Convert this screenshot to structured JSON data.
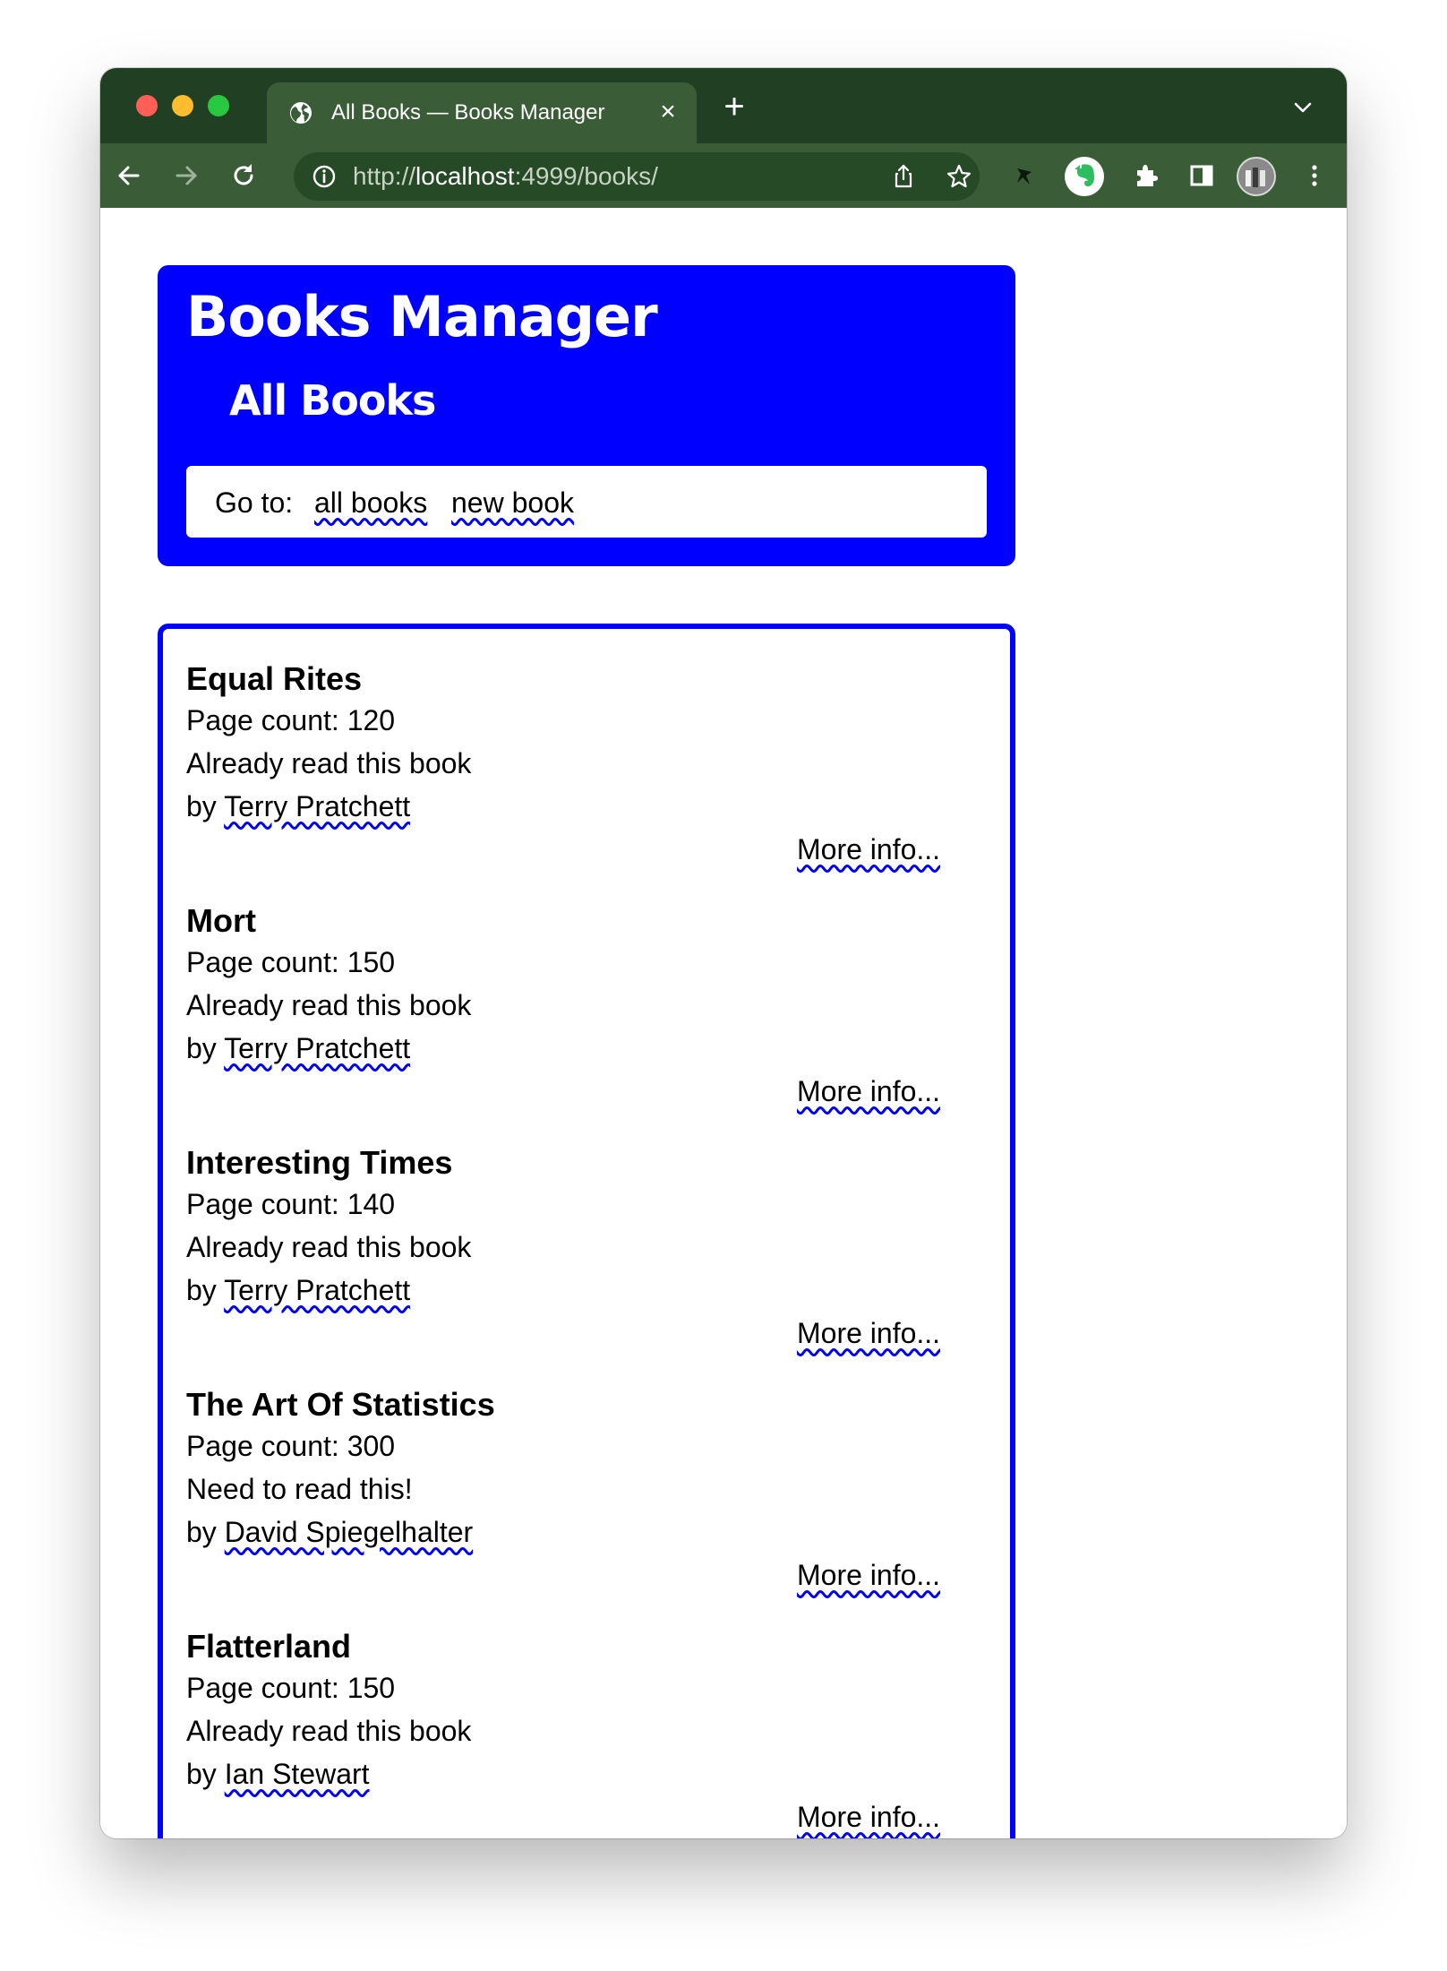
{
  "browser": {
    "tab_title": "All Books — Books Manager",
    "tab_close": "×",
    "new_tab": "+",
    "url_prefix": "http://",
    "url_host": "localhost",
    "url_rest": ":4999/books/"
  },
  "header": {
    "site_title": "Books Manager",
    "page_heading": "All Books",
    "nav_label": "Go to:",
    "nav_links": [
      "all books",
      "new book"
    ]
  },
  "books": [
    {
      "title": "Equal Rites",
      "pages": "Page count: 120",
      "status": "Already read this book",
      "by": "by",
      "author": "Terry Pratchett",
      "more": "More info..."
    },
    {
      "title": "Mort",
      "pages": "Page count: 150",
      "status": "Already read this book",
      "by": "by",
      "author": "Terry Pratchett",
      "more": "More info..."
    },
    {
      "title": "Interesting Times",
      "pages": "Page count: 140",
      "status": "Already read this book",
      "by": "by",
      "author": "Terry Pratchett",
      "more": "More info..."
    },
    {
      "title": "The Art Of Statistics",
      "pages": "Page count: 300",
      "status": "Need to read this!",
      "by": "by",
      "author": "David Spiegelhalter",
      "more": "More info..."
    },
    {
      "title": "Flatterland",
      "pages": "Page count: 150",
      "status": "Already read this book",
      "by": "by",
      "author": "Ian Stewart",
      "more": "More info..."
    }
  ],
  "colors": {
    "accent": "#0000ff",
    "chrome_frame": "#213f22",
    "chrome_toolbar": "#3a5c36",
    "omnibox": "#274a26"
  },
  "icons": {
    "tab_favicon": "globe-icon",
    "back": "arrow-left-icon",
    "forward": "arrow-right-icon",
    "reload": "reload-icon",
    "site_info": "info-icon",
    "share": "share-icon",
    "bookmark": "star-icon",
    "extension_pin": "pin-icon",
    "evernote": "evernote-icon",
    "extensions": "puzzle-icon",
    "side_panel": "side-panel-icon",
    "profile": "avatar",
    "menu": "kebab-menu-icon"
  }
}
